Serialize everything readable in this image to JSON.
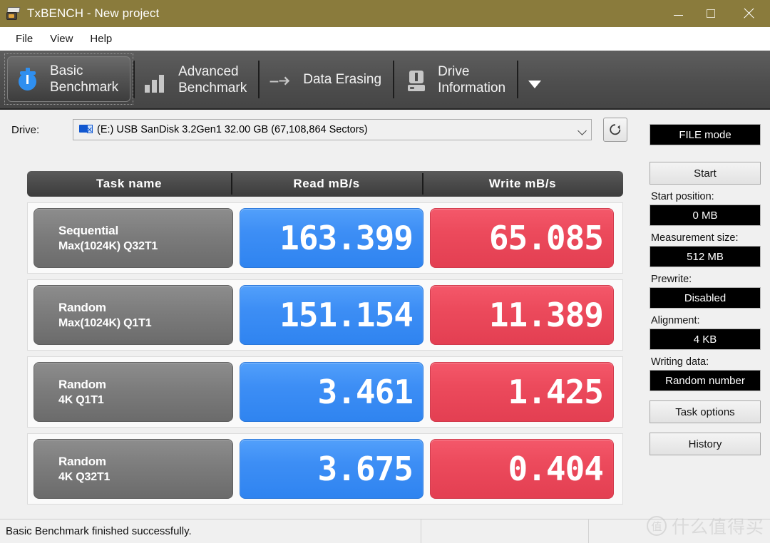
{
  "window": {
    "title": "TxBENCH - New project",
    "icon": "drive-device-icon",
    "controls": {
      "minimize": "minimize-icon",
      "maximize": "maximize-icon",
      "close": "close-icon"
    }
  },
  "menubar": {
    "items": [
      {
        "label": "File"
      },
      {
        "label": "View"
      },
      {
        "label": "Help"
      }
    ]
  },
  "tabs": [
    {
      "label": "Basic\nBenchmark",
      "icon": "stopwatch-icon",
      "selected": true
    },
    {
      "label": "Advanced\nBenchmark",
      "icon": "bar-chart-icon",
      "selected": false
    },
    {
      "label": "Data Erasing",
      "icon": "erase-zigzag-icon",
      "selected": false
    },
    {
      "label": "Drive\nInformation",
      "icon": "drive-info-icon",
      "selected": false
    }
  ],
  "tab_overflow_icon": "chevron-down-icon",
  "drive": {
    "label": "Drive:",
    "selected": "(E:) USB SanDisk 3.2Gen1  32.00 GB (67,108,864 Sectors)",
    "icon": "removable-drive-icon",
    "dropdown_icon": "chevron-down-icon",
    "refresh_icon": "refresh-icon"
  },
  "results": {
    "columns": [
      "Task name",
      "Read mB/s",
      "Write mB/s"
    ],
    "rows": [
      {
        "task_line1": "Sequential",
        "task_line2": "Max(1024K) Q32T1",
        "read": "163.399",
        "write": "65.085"
      },
      {
        "task_line1": "Random",
        "task_line2": "Max(1024K) Q1T1",
        "read": "151.154",
        "write": "11.389"
      },
      {
        "task_line1": "Random",
        "task_line2": "4K Q1T1",
        "read": "3.461",
        "write": "1.425"
      },
      {
        "task_line1": "Random",
        "task_line2": "4K Q32T1",
        "read": "3.675",
        "write": "0.404"
      }
    ]
  },
  "panel": {
    "mode": "FILE mode",
    "start_button": "Start",
    "start_position_label": "Start position:",
    "start_position_value": "0 MB",
    "measurement_size_label": "Measurement size:",
    "measurement_size_value": "512 MB",
    "prewrite_label": "Prewrite:",
    "prewrite_value": "Disabled",
    "alignment_label": "Alignment:",
    "alignment_value": "4 KB",
    "writing_data_label": "Writing data:",
    "writing_data_value": "Random number",
    "task_options_button": "Task options",
    "history_button": "History"
  },
  "statusbar": {
    "message": "Basic Benchmark finished successfully."
  },
  "watermark": {
    "badge": "值",
    "text": "什么值得买"
  },
  "colors": {
    "titlebar": "#8a7b3c",
    "read_accent": "#3d8ef5",
    "write_accent": "#ec4a5c",
    "tabbar": "#4e4e4e",
    "panel_field_bg": "#000000"
  }
}
